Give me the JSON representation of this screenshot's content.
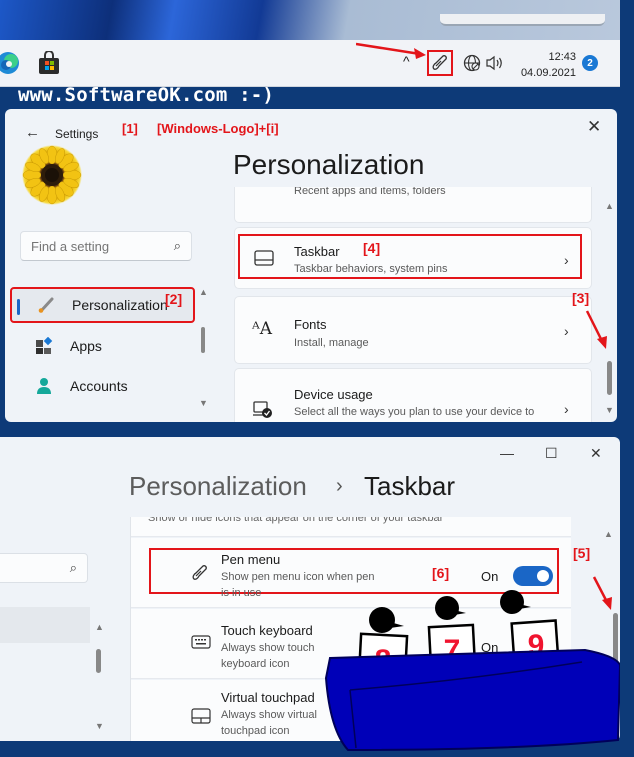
{
  "watermark_site": "www.SoftwareOK.com :-)",
  "taskbar": {
    "apps": [
      "edge-icon",
      "microsoft-store-icon"
    ],
    "tray": {
      "overflow_chevron": "^",
      "icons": [
        "pen-icon",
        "network-icon",
        "volume-icon"
      ],
      "time": "12:43",
      "date": "04.09.2021",
      "notification_count": "2"
    }
  },
  "settings_window": {
    "back_label": "←",
    "title": "Settings",
    "annotation_1": "[1]",
    "shortcut_hint": "[Windows-Logo]+[i]",
    "close_label": "✕",
    "search": {
      "placeholder": "Find a setting",
      "icon": "⌕"
    },
    "nav": [
      {
        "label": "Personalization",
        "icon": "brush-icon",
        "active": true,
        "annotation": "[2]"
      },
      {
        "label": "Apps",
        "icon": "apps-icon",
        "active": false
      },
      {
        "label": "Accounts",
        "icon": "accounts-icon",
        "active": false
      }
    ],
    "page_title": "Personalization",
    "cards": [
      {
        "title": "",
        "subtitle": "Recent apps and items, folders"
      },
      {
        "title": "Taskbar",
        "subtitle": "Taskbar behaviors, system pins",
        "annotation": "[4]",
        "icon": "taskbar-icon"
      },
      {
        "title": "Fonts",
        "subtitle": "Install, manage",
        "icon": "fonts-icon"
      },
      {
        "title": "Device usage",
        "subtitle": "Select all the ways you plan to use your device to",
        "icon": "device-usage-icon"
      }
    ],
    "scroll_annotation": "[3]"
  },
  "taskbar_settings_window": {
    "controls": {
      "minimize": "—",
      "maximize": "☐",
      "close": "✕"
    },
    "breadcrumb": {
      "parent": "Personalization",
      "separator": "›",
      "current": "Taskbar"
    },
    "partial_text": "Show or hide icons that appear on the corner of your taskbar",
    "scroll_annotation": "[5]",
    "rows": [
      {
        "title": "Pen menu",
        "subtitle": "Show pen menu icon when pen is in use",
        "state": "On",
        "toggle_on": true,
        "annotation": "[6]",
        "icon": "pen-icon"
      },
      {
        "title": "Touch keyboard",
        "subtitle": "Always show touch keyboard icon",
        "state": "On",
        "icon": "keyboard-icon"
      },
      {
        "title": "Virtual touchpad",
        "subtitle": "Always show virtual touchpad icon",
        "icon": "touchpad-icon"
      }
    ]
  },
  "judges": {
    "scores": [
      "8",
      "7",
      "9"
    ]
  }
}
